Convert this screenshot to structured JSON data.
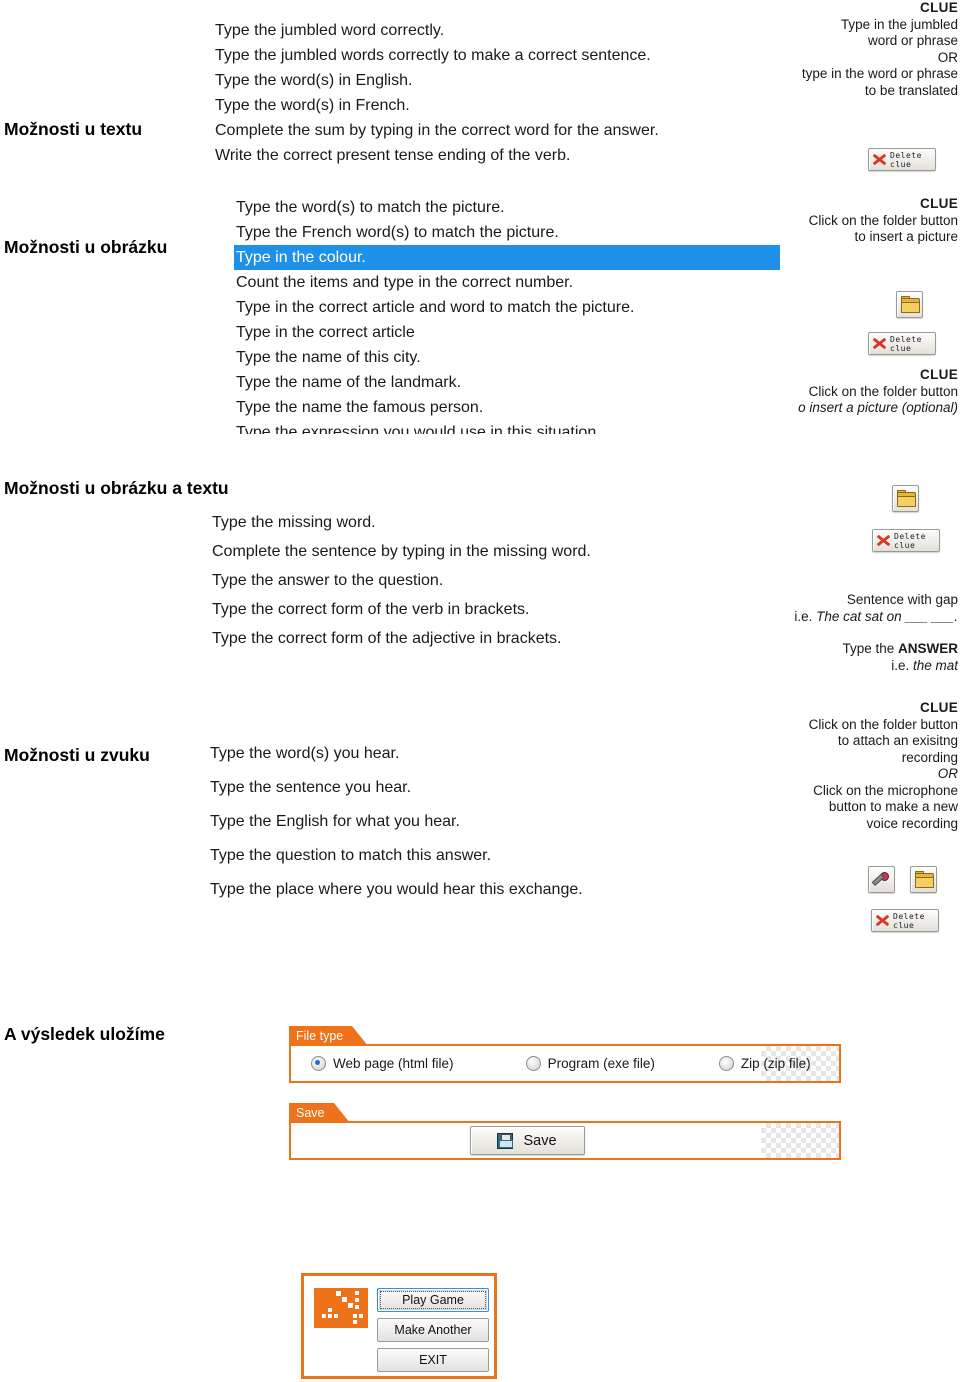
{
  "sections": [
    {
      "label": "Možnosti u textu",
      "options": [
        "Type the jumbled word correctly.",
        "Type the jumbled words correctly to make a correct sentence.",
        "Type the word(s) in English.",
        "Type the word(s) in French.",
        "Complete the sum by typing in the correct word for the answer.",
        "Write the correct present tense ending of the verb."
      ],
      "clue": {
        "title": "CLUE",
        "lines": [
          "Type in the jumbled",
          "word or phrase",
          "OR",
          "type in the word or phrase",
          "to be translated"
        ],
        "delete_label_line1": "Delete",
        "delete_label_line2": "clue"
      }
    },
    {
      "label": "Možnosti u obrázku",
      "options": [
        "Type the word(s) to match the picture.",
        "Type the French word(s) to match the picture.",
        "Type in the colour.",
        "Count the items and type in the correct number.",
        "Type in the correct article and word to match the picture.",
        "Type in the correct article",
        "Type the name of this city.",
        "Type the name of the landmark.",
        "Type the name the famous person.",
        "Type the expression you would use in this situation"
      ],
      "selected_index": 2,
      "clue_top": {
        "title": "CLUE",
        "lines": [
          "Click on the folder button",
          "to insert a picture"
        ]
      },
      "clue_bottom": {
        "title": "CLUE",
        "lines": [
          "Click on the folder button",
          "o insert a picture (optional)"
        ]
      },
      "delete_label_line1": "Delete",
      "delete_label_line2": "clue"
    },
    {
      "label": "Možnosti u obrázku a textu",
      "options": [
        "Type the missing word.",
        "Complete the sentence by typing in the missing word.",
        "Type the answer to the question.",
        "Type the correct form of the verb in brackets.",
        "Type the correct form of the adjective in brackets."
      ],
      "delete_label_line1": "Delete",
      "delete_label_line2": "clue",
      "gap_hint": {
        "line1": "Sentence with gap",
        "line2_prefix": "i.e. ",
        "line2_italic": "The cat sat on ___ ___.",
        "line3_prefix": "Type the ",
        "line3_bold": "ANSWER",
        "line4_prefix": "i.e. ",
        "line4_italic": "the mat"
      }
    },
    {
      "label": "Možnosti u zvuku",
      "options": [
        "Type the word(s) you hear.",
        "Type the sentence you hear.",
        "Type the English for what you hear.",
        "Type the question to match this answer.",
        "Type the place where you would hear this exchange."
      ],
      "clue": {
        "title": "CLUE",
        "lines": [
          "Click on the folder button",
          "to attach an exisitng",
          "recording",
          "OR",
          "Click on the microphone",
          "button to make a new",
          "voice recording"
        ]
      },
      "delete_label_line1": "Delete",
      "delete_label_line2": "clue"
    }
  ],
  "save_section": {
    "label": "A výsledek uložíme",
    "file_type_panel": {
      "tab": "File type",
      "options": [
        {
          "label": "Web page (html file)",
          "selected": true
        },
        {
          "label": "Program (exe file)",
          "selected": false
        },
        {
          "label": "Zip (zip file)",
          "selected": false
        }
      ]
    },
    "save_panel": {
      "tab": "Save",
      "button_label": "Save"
    }
  },
  "mini_window": {
    "buttons": [
      {
        "label": "Play Game",
        "focused": true
      },
      {
        "label": "Make Another",
        "focused": false
      },
      {
        "label": "EXIT",
        "focused": false
      }
    ]
  },
  "colors": {
    "accent_orange": "#ee7219",
    "selection_blue": "#1e90e8",
    "text": "#1a1a1a"
  }
}
